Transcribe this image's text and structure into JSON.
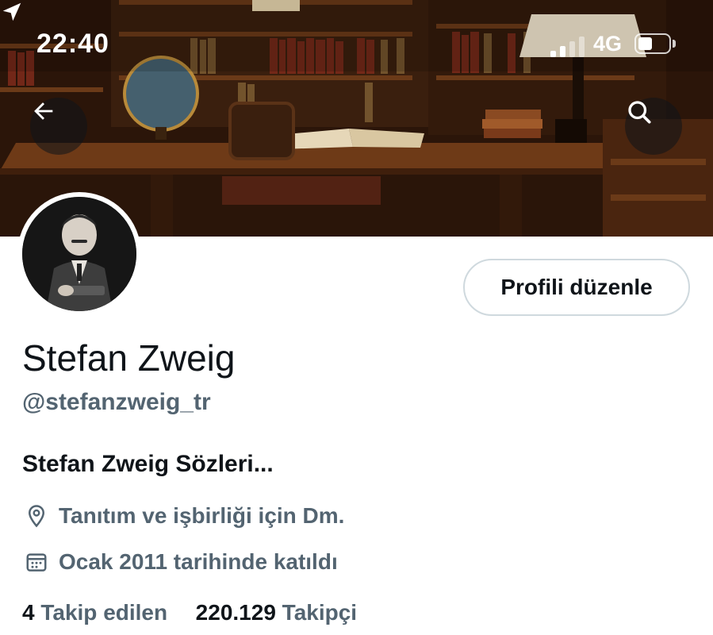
{
  "status_bar": {
    "time": "22:40",
    "network": "4G",
    "location_icon": "location-arrow-icon",
    "battery_level": 0.4
  },
  "header": {
    "back_icon": "back-arrow-icon",
    "search_icon": "search-icon"
  },
  "profile": {
    "name": "Stefan Zweig",
    "handle": "@stefanzweig_tr",
    "bio": "Stefan Zweig Sözleri...",
    "location": "Tanıtım ve işbirliği için Dm.",
    "joined": "Ocak 2011 tarihinde katıldı",
    "edit_button_label": "Profili düzenle"
  },
  "stats": {
    "following_count": "4",
    "following_label": "Takip edilen",
    "followers_count": "220.129",
    "followers_label": "Takipçi"
  },
  "colors": {
    "text_primary": "#0f1419",
    "text_secondary": "#536471",
    "border": "#cfd9de"
  }
}
